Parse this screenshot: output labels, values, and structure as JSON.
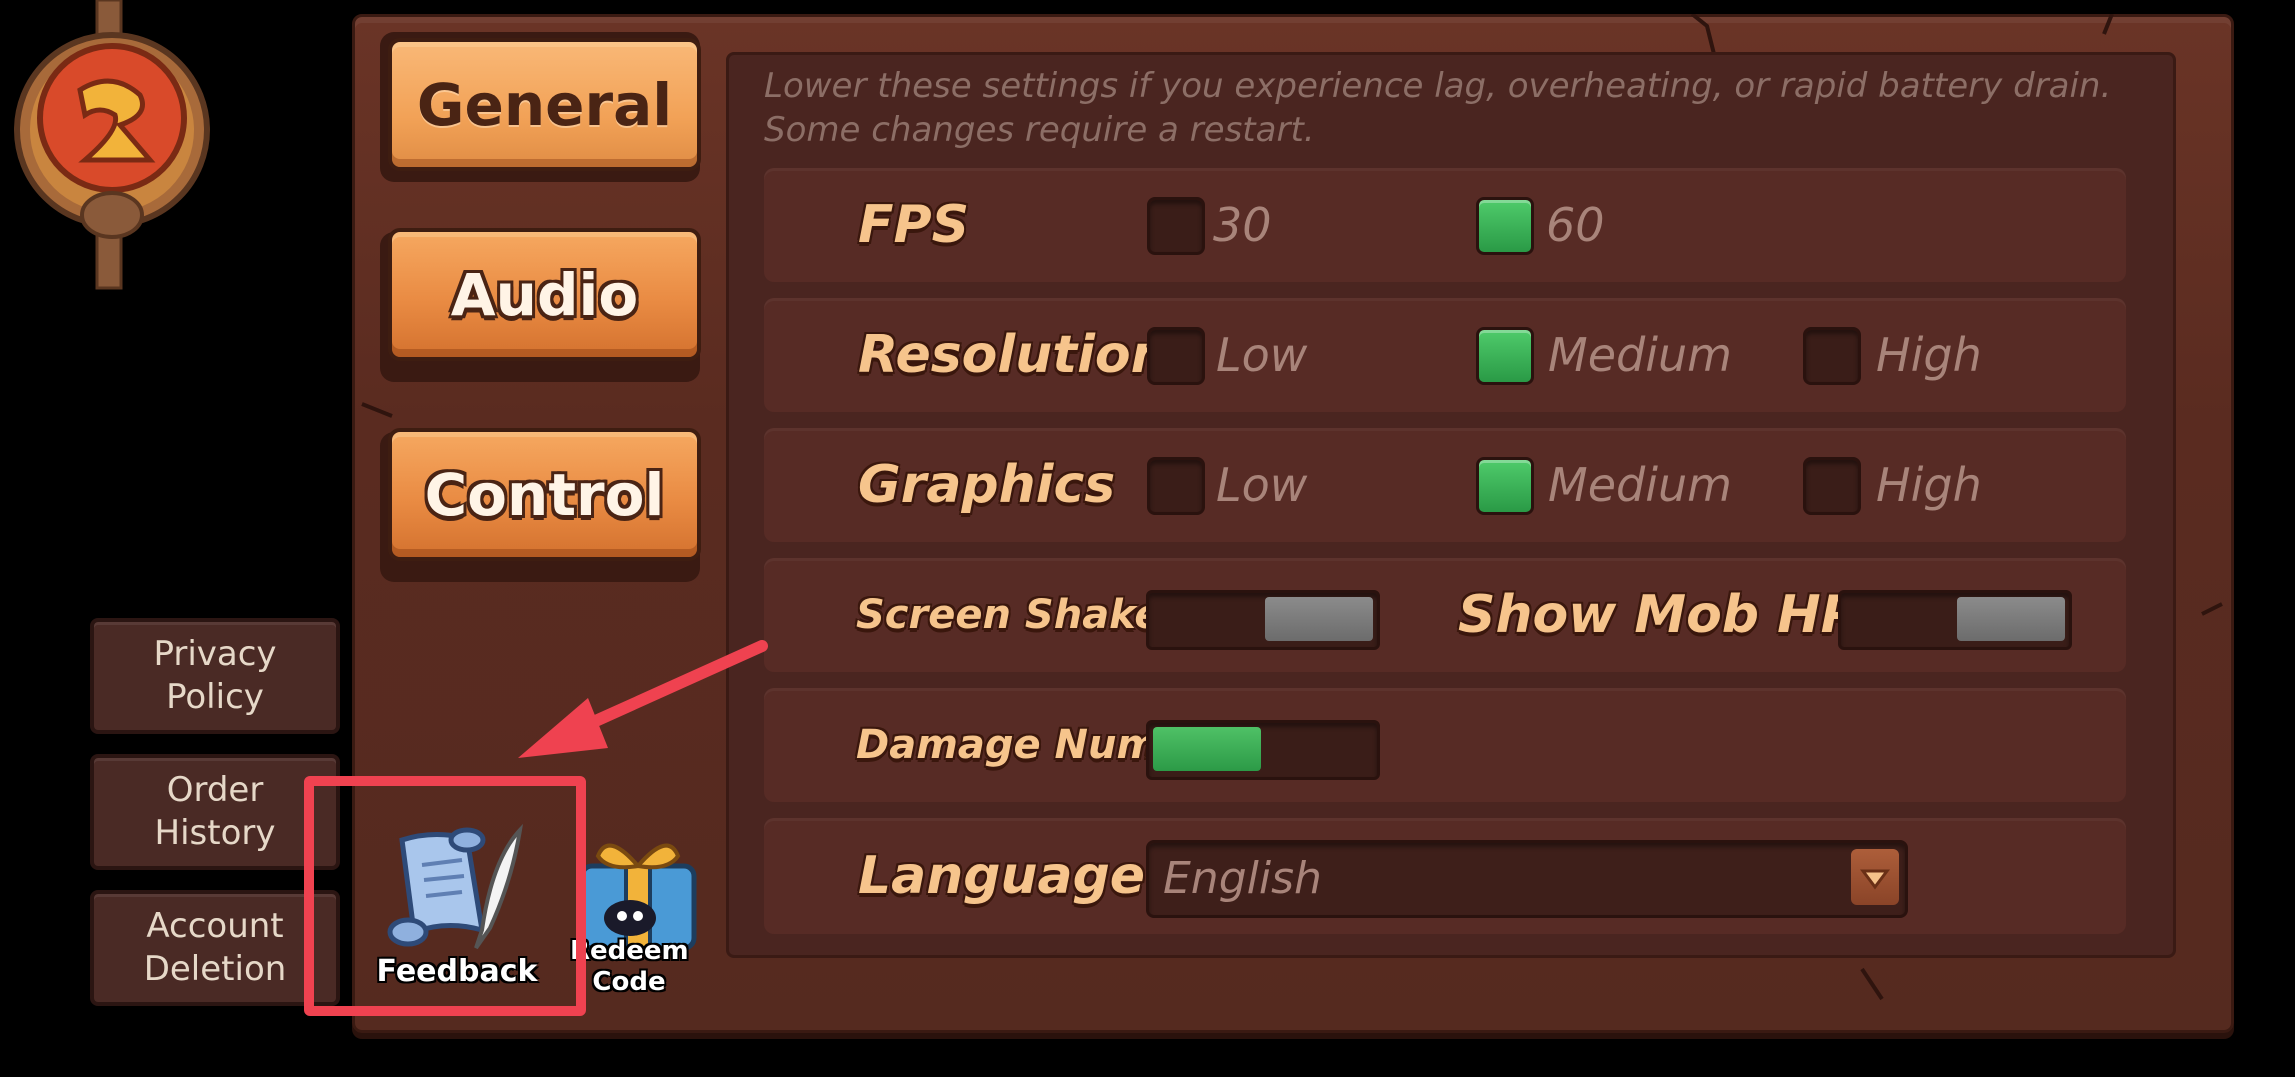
{
  "tabs": [
    {
      "label": "General",
      "active": true
    },
    {
      "label": "Audio",
      "active": false
    },
    {
      "label": "Control",
      "active": false
    }
  ],
  "side_links": [
    {
      "line1": "Privacy",
      "line2": "Policy"
    },
    {
      "line1": "Order",
      "line2": "History"
    },
    {
      "line1": "Account",
      "line2": "Deletion"
    }
  ],
  "hint": {
    "line1": "Lower these settings if you experience lag, overheating, or rapid battery drain.",
    "line2": "Some changes require a restart."
  },
  "settings": {
    "fps": {
      "label": "FPS",
      "options": [
        "30",
        "60"
      ],
      "selected": "60"
    },
    "resolution": {
      "label": "Resolution",
      "options": [
        "Low",
        "Medium",
        "High"
      ],
      "selected": "Medium"
    },
    "graphics": {
      "label": "Graphics",
      "options": [
        "Low",
        "Medium",
        "High"
      ],
      "selected": "Medium"
    },
    "screen_shake": {
      "label": "Screen Shake",
      "enabled": false
    },
    "show_mob_hp": {
      "label": "Show Mob HP",
      "enabled": false
    },
    "damage_num": {
      "label": "Damage Num",
      "enabled": true
    },
    "language": {
      "label": "Language",
      "value": "English"
    }
  },
  "bottom_icons": {
    "feedback": {
      "label": "Feedback",
      "icon": "scroll-quill-icon"
    },
    "redeem": {
      "line1": "Redeem",
      "line2": "Code",
      "icon": "gift-box-icon"
    }
  },
  "annotation_color": "#ef4250"
}
